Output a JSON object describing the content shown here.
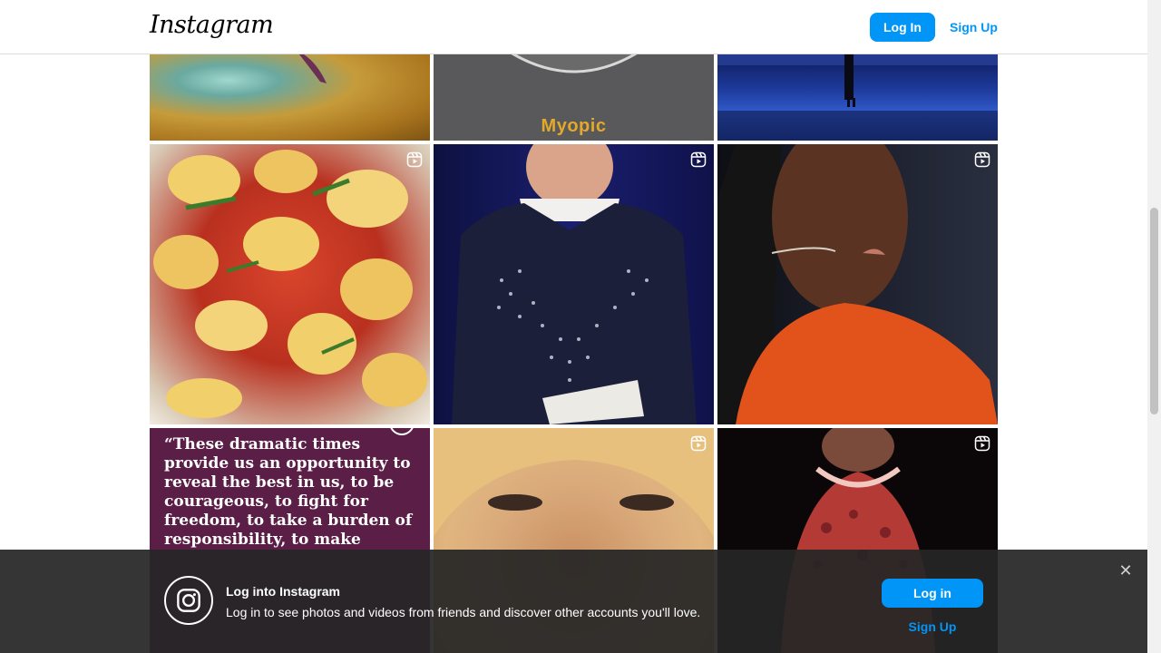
{
  "header": {
    "logo_text": "Instagram",
    "login_label": "Log In",
    "signup_label": "Sign Up"
  },
  "grid": {
    "myopic_label": "Myopic",
    "quote_text": "“These dramatic times provide us an opportunity to reveal the best in us, to be courageous, to fight for freedom, to take a burden of responsibility, to make"
  },
  "banner": {
    "title": "Log into Instagram",
    "text": "Log in to see photos and videos from friends and discover other accounts you'll love.",
    "login_label": "Log in",
    "signup_label": "Sign Up",
    "close_glyph": "✕"
  },
  "colors": {
    "brand_blue": "#0095f6",
    "banner_bg": "#262626",
    "myopic_text": "#e3a92a"
  },
  "icons": {
    "reel": "reel-icon",
    "instagram": "instagram-icon",
    "close": "close-icon"
  }
}
